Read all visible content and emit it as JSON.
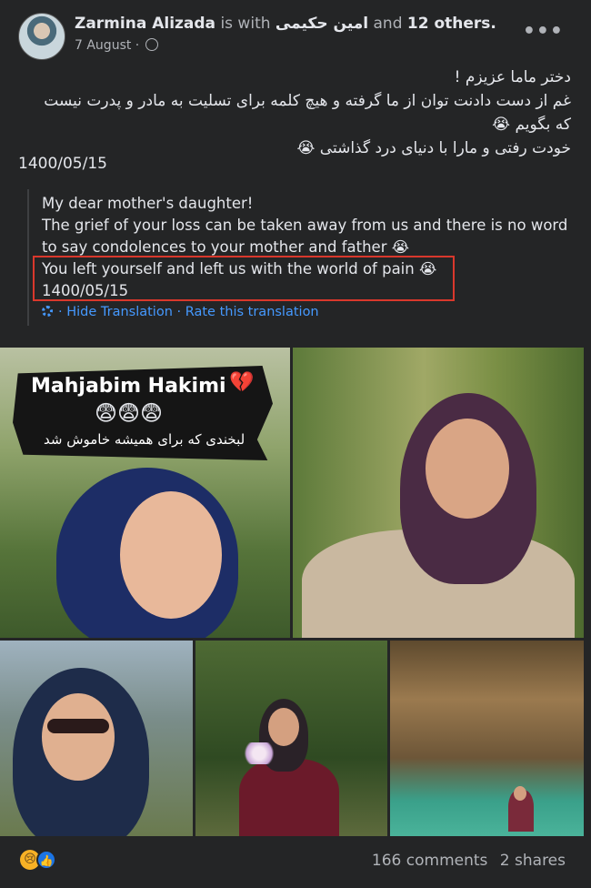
{
  "header": {
    "name": "Zarmina Alizada",
    "is_with_text": "is with",
    "tagged_name": "امین حکیمی",
    "and_text": "and",
    "others": "12 others.",
    "date": "7 August ·",
    "more": "•••"
  },
  "post": {
    "persian_lines": [
      "دختر ماما عزیزم !",
      "غم از دست دادنت توان از ما گرفته و هیچ کلمه برای تسلیت به مادر و پدرت نیست که بگویم 😭",
      "خودت رفتی و مارا با دنیای درد گذاشتی 😭"
    ],
    "date_text": "1400/05/15"
  },
  "translation": {
    "lines": [
      "My dear mother's daughter!",
      "The grief of your loss can be taken away from us and there is no word",
      "to say condolences to your mother and father 😭",
      "You left yourself and left us with the world of pain 😭",
      "1400/05/15"
    ],
    "hide_label": "· Hide Translation",
    "rate_label": "· Rate this translation"
  },
  "photos": {
    "banner_title": "Mahjabim Hakimi",
    "banner_emojis": "😨😨😨",
    "banner_persian": "لبخندی که برای همیشه خاموش شد",
    "broken_heart": "💔"
  },
  "footer": {
    "reaction1": "😢",
    "reaction2": "👍",
    "comments": "166 comments",
    "shares": "2 shares"
  }
}
